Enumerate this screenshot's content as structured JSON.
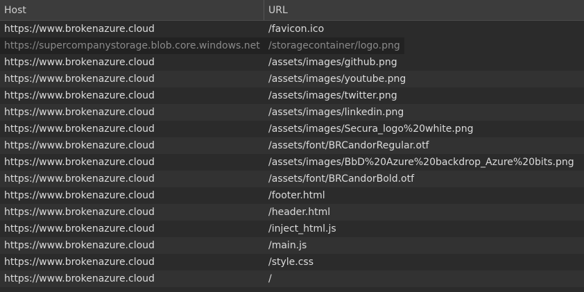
{
  "table": {
    "columns": {
      "host": "Host",
      "url": "URL"
    },
    "rows": [
      {
        "host": "https://www.brokenazure.cloud",
        "url": "/favicon.ico"
      },
      {
        "host": "https://supercompanystorage.blob.core.windows.net",
        "url": "/storagecontainer/logo.png",
        "state": "dimmed"
      },
      {
        "host": "https://www.brokenazure.cloud",
        "url": "/assets/images/github.png"
      },
      {
        "host": "https://www.brokenazure.cloud",
        "url": "/assets/images/youtube.png"
      },
      {
        "host": "https://www.brokenazure.cloud",
        "url": "/assets/images/twitter.png"
      },
      {
        "host": "https://www.brokenazure.cloud",
        "url": "/assets/images/linkedin.png"
      },
      {
        "host": "https://www.brokenazure.cloud",
        "url": "/assets/images/Secura_logo%20white.png"
      },
      {
        "host": "https://www.brokenazure.cloud",
        "url": "/assets/font/BRCandorRegular.otf"
      },
      {
        "host": "https://www.brokenazure.cloud",
        "url": "/assets/images/BbD%20Azure%20backdrop_Azure%20bits.png"
      },
      {
        "host": "https://www.brokenazure.cloud",
        "url": "/assets/font/BRCandorBold.otf"
      },
      {
        "host": "https://www.brokenazure.cloud",
        "url": "/footer.html"
      },
      {
        "host": "https://www.brokenazure.cloud",
        "url": "/header.html"
      },
      {
        "host": "https://www.brokenazure.cloud",
        "url": "/inject_html.js"
      },
      {
        "host": "https://www.brokenazure.cloud",
        "url": "/main.js"
      },
      {
        "host": "https://www.brokenazure.cloud",
        "url": "/style.css"
      },
      {
        "host": "https://www.brokenazure.cloud",
        "url": "/"
      }
    ]
  },
  "colors": {
    "background": "#2b2b2b",
    "header_background": "#3c3c3c",
    "text": "#dcdcdc",
    "dimmed_text": "#8a8a8a"
  }
}
